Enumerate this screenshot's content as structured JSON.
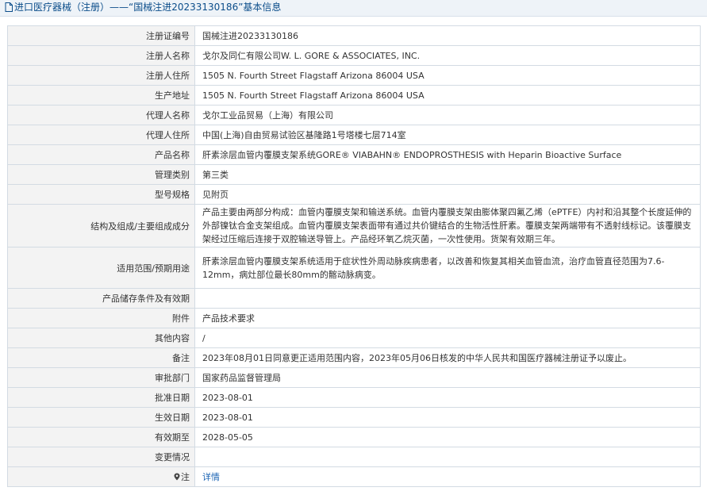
{
  "header": {
    "title": "进口医疗器械（注册）——“国械注进20233130186”基本信息"
  },
  "rows": {
    "reg_no": {
      "label": "注册证编号",
      "value": "国械注进20233130186"
    },
    "registrant": {
      "label": "注册人名称",
      "value": "戈尔及同仁有限公司W. L. GORE & ASSOCIATES, INC."
    },
    "reg_address": {
      "label": "注册人住所",
      "value": "1505 N. Fourth Street Flagstaff Arizona 86004 USA"
    },
    "mfg_address": {
      "label": "生产地址",
      "value": "1505 N. Fourth Street Flagstaff Arizona 86004 USA"
    },
    "agent": {
      "label": "代理人名称",
      "value": "戈尔工业品贸易（上海）有限公司"
    },
    "agent_addr": {
      "label": "代理人住所",
      "value": "中国(上海)自由贸易试验区基隆路1号塔楼七层714室"
    },
    "product": {
      "label": "产品名称",
      "value": "肝素涂层血管内覆膜支架系统GORE® VIABAHN® ENDOPROSTHESIS with Heparin Bioactive Surface"
    },
    "category": {
      "label": "管理类别",
      "value": "第三类"
    },
    "model": {
      "label": "型号规格",
      "value": "见附页"
    },
    "structure": {
      "label": "结构及组成/主要组成成分",
      "value": "产品主要由两部分构成：血管内覆膜支架和输送系统。血管内覆膜支架由膨体聚四氟乙烯（ePTFE）内衬和沿其整个长度延伸的外部镍钛合金支架组成。血管内覆膜支架表面带有通过共价键结合的生物活性肝素。覆膜支架两端带有不透射线标记。该覆膜支架经过压缩后连接于双腔输送导管上。产品经环氧乙烷灭菌，一次性使用。货架有效期三年。"
    },
    "scope": {
      "label": "适用范围/预期用途",
      "value": "肝素涂层血管内覆膜支架系统适用于症状性外周动脉疾病患者，以改善和恢复其相关血管血流，治疗血管直径范围为7.6-12mm，病灶部位最长80mm的髂动脉病变。"
    },
    "storage": {
      "label": "产品储存条件及有效期",
      "value": ""
    },
    "attachment": {
      "label": "附件",
      "value": "产品技术要求"
    },
    "other": {
      "label": "其他内容",
      "value": "/"
    },
    "remark": {
      "label": "备注",
      "value": "2023年08月01日同意更正适用范围内容，2023年05月06日核发的中华人民共和国医疗器械注册证予以废止。"
    },
    "dept": {
      "label": "审批部门",
      "value": "国家药品监督管理局"
    },
    "approve": {
      "label": "批准日期",
      "value": "2023-08-01"
    },
    "effective": {
      "label": "生效日期",
      "value": "2023-08-01"
    },
    "expiry": {
      "label": "有效期至",
      "value": "2028-05-05"
    },
    "changes": {
      "label": "变更情况",
      "value": ""
    },
    "note": {
      "label": "注",
      "value": "详情"
    }
  },
  "colors": {
    "title": "#0b4d8a",
    "link": "#1a63b3",
    "label_bg": "#f3f3f3",
    "border": "#d3dbe3"
  },
  "icons": {
    "title": "document-icon",
    "note": "pin-icon"
  }
}
